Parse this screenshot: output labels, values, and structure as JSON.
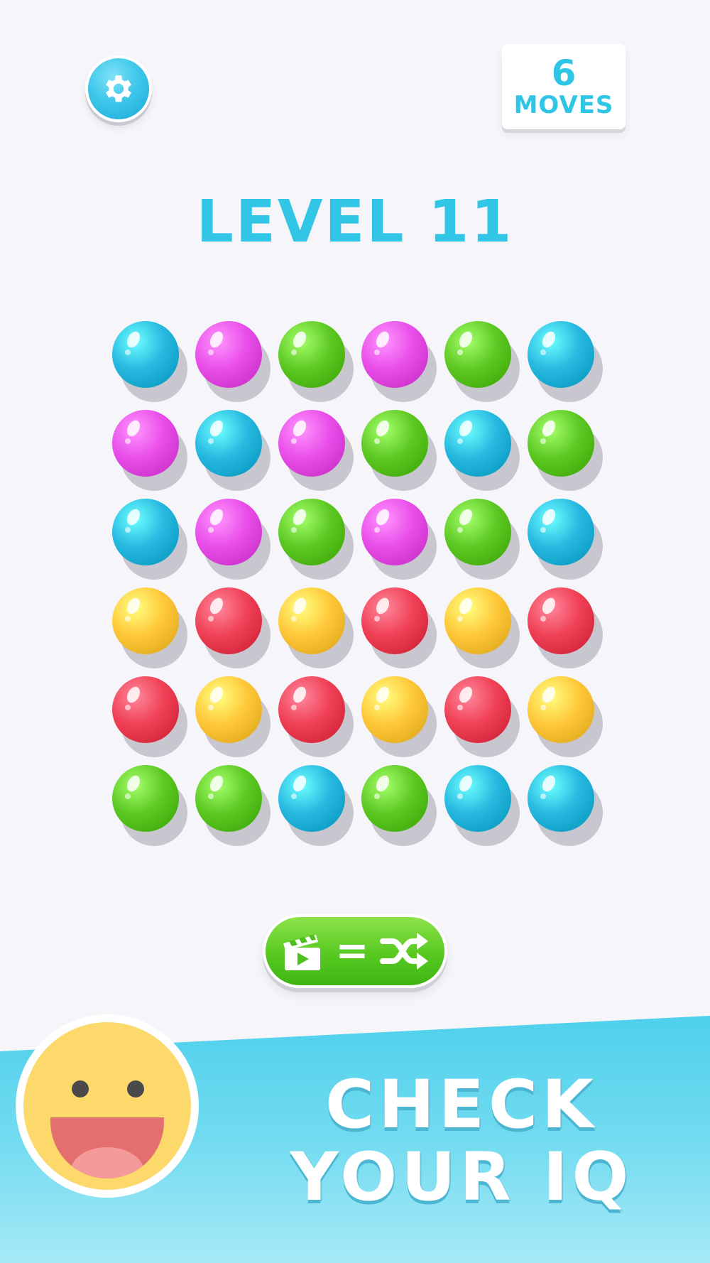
{
  "header": {
    "settings_icon": "gear-icon",
    "moves": {
      "count": "6",
      "label": "MOVES"
    }
  },
  "level": {
    "title": "LEVEL 11"
  },
  "board": {
    "rows": 6,
    "cols": 6,
    "colors": {
      "blue": "#27b9e0",
      "pink": "#e94ee9",
      "green": "#5ec924",
      "yellow": "#ffc83a",
      "red": "#f04156"
    },
    "grid": [
      [
        "blue",
        "pink",
        "green",
        "pink",
        "green",
        "blue"
      ],
      [
        "pink",
        "blue",
        "pink",
        "green",
        "blue",
        "green"
      ],
      [
        "blue",
        "pink",
        "green",
        "pink",
        "green",
        "blue"
      ],
      [
        "yellow",
        "red",
        "yellow",
        "red",
        "yellow",
        "red"
      ],
      [
        "red",
        "yellow",
        "red",
        "yellow",
        "red",
        "yellow"
      ],
      [
        "green",
        "green",
        "blue",
        "green",
        "blue",
        "blue"
      ]
    ]
  },
  "shuffle_button": {
    "icons": [
      "clapperboard-icon",
      "shuffle-icon"
    ],
    "equals": "="
  },
  "banner": {
    "line1": "CHECK",
    "line2": "YOUR IQ",
    "mascot": "smiley-face-icon"
  }
}
